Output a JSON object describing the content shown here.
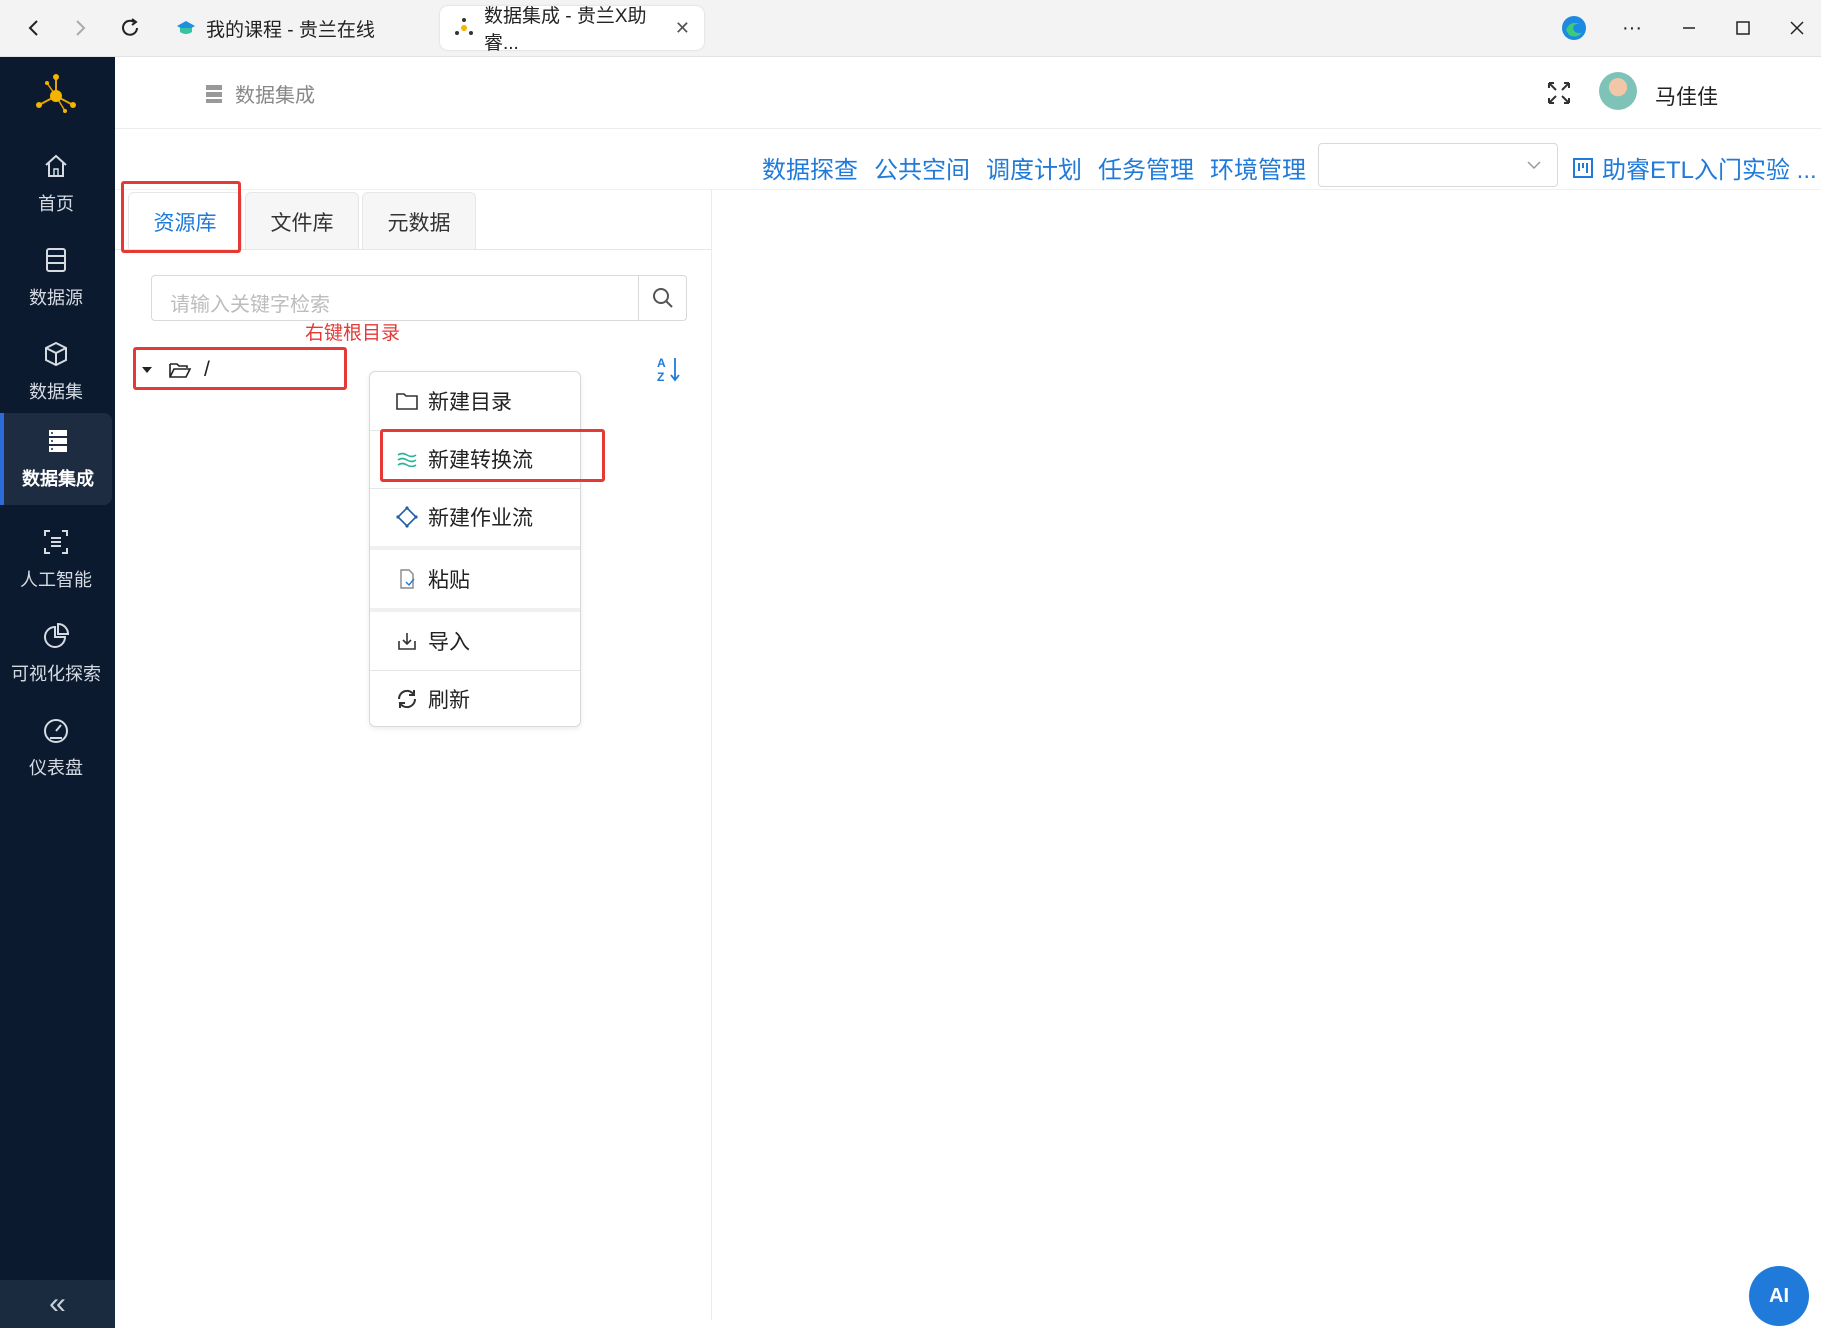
{
  "browser": {
    "tabs": [
      {
        "title": "我的课程 - 贵兰在线"
      },
      {
        "title": "数据集成 - 贵兰X助睿..."
      }
    ],
    "close_glyph": "✕",
    "more_glyph": "···"
  },
  "sidebar": {
    "items": [
      {
        "label": "首页",
        "icon": "home-icon"
      },
      {
        "label": "数据源",
        "icon": "datasource-icon"
      },
      {
        "label": "数据集",
        "icon": "cube-icon"
      },
      {
        "label": "数据集成",
        "icon": "server-icon",
        "active": true
      },
      {
        "label": "人工智能",
        "icon": "ai-icon"
      },
      {
        "label": "可视化探索",
        "icon": "pie-icon"
      },
      {
        "label": "仪表盘",
        "icon": "gauge-icon"
      }
    ],
    "collapse_glyph": "«"
  },
  "header": {
    "breadcrumb": "数据集成",
    "username": "马佳佳"
  },
  "toplinks": [
    "数据探查",
    "公共空间",
    "调度计划",
    "任务管理",
    "环境管理"
  ],
  "project_link": "助睿ETL入门实验 ...",
  "panel": {
    "tabs": [
      "资源库",
      "文件库",
      "元数据"
    ],
    "active_tab": 0,
    "search_placeholder": "请输入关键字检索",
    "annotation": "右键根目录",
    "root_label": "/"
  },
  "context_menu": [
    {
      "label": "新建目录",
      "icon": "folder-icon"
    },
    {
      "label": "新建转换流",
      "icon": "transform-icon"
    },
    {
      "label": "新建作业流",
      "icon": "job-icon"
    },
    {
      "label": "粘贴",
      "icon": "paste-icon"
    },
    {
      "label": "导入",
      "icon": "import-icon"
    },
    {
      "label": "刷新",
      "icon": "refresh-icon"
    }
  ],
  "ai_button": "AI",
  "colors": {
    "sidebar_bg": "#0b1a2e",
    "accent": "#1f7ad9",
    "annotation_red": "#e53935"
  }
}
